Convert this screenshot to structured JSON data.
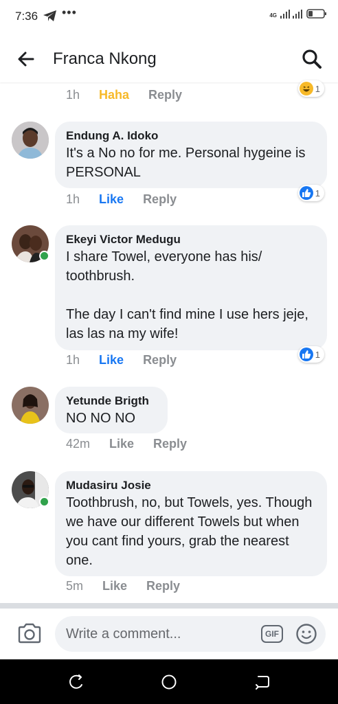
{
  "status_bar": {
    "time": "7:36",
    "overflow": "•••",
    "network": "4G",
    "icons": [
      "telegram-icon",
      "signal-icon",
      "battery-icon"
    ]
  },
  "header": {
    "title": "Franca Nkong",
    "icons": [
      "back-arrow-icon",
      "search-icon"
    ]
  },
  "partial_comment": {
    "time": "1h",
    "reaction_label": "Haha",
    "reply_label": "Reply",
    "reaction_count": "1",
    "reaction_type": "haha"
  },
  "comments": [
    {
      "author": "Endung A. Idoko",
      "text": "It's a No no for me. Personal hygeine is PERSONAL",
      "time": "1h",
      "like_label": "Like",
      "reply_label": "Reply",
      "liked": true,
      "reaction_count": "1",
      "reaction_type": "like",
      "online": false
    },
    {
      "author": "Ekeyi Victor Medugu",
      "text": "I share Towel, everyone has his/ toothbrush.\n\nThe day I can't find mine I use hers jeje, las las na my wife!",
      "time": "1h",
      "like_label": "Like",
      "reply_label": "Reply",
      "liked": true,
      "reaction_count": "1",
      "reaction_type": "like",
      "online": true
    },
    {
      "author": "Yetunde Brigth",
      "text": "NO NO NO",
      "time": "42m",
      "like_label": "Like",
      "reply_label": "Reply",
      "liked": false,
      "online": false
    },
    {
      "author": "Mudasiru Josie",
      "text": "Toothbrush, no, but Towels, yes. Though we have our different Towels but when you cant find yours, grab the nearest one.",
      "time": "5m",
      "like_label": "Like",
      "reply_label": "Reply",
      "liked": false,
      "online": true
    }
  ],
  "composer": {
    "placeholder": "Write a comment...",
    "gif_label": "GIF",
    "icons": [
      "camera-icon",
      "gif-icon",
      "emoji-icon"
    ]
  },
  "nav_bar": {
    "icons": [
      "recent-apps-icon",
      "home-icon",
      "back-icon"
    ]
  },
  "colors": {
    "accent": "#1877f2",
    "haha": "#f7b928",
    "bubble": "#f0f2f5",
    "muted": "#8a8d91",
    "online": "#31a24c"
  }
}
